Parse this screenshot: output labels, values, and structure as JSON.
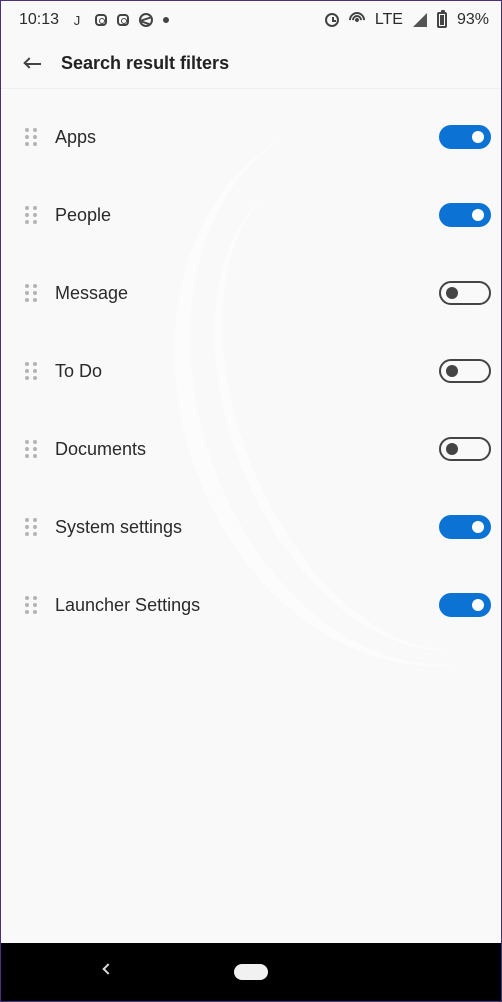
{
  "status_bar": {
    "time": "10:13",
    "left_icons": [
      "j-icon",
      "instagram-icon",
      "instagram-icon",
      "globe-icon",
      "dot-icon"
    ],
    "right_icons": [
      "alarm-icon",
      "hotspot-icon",
      "signal-icon",
      "battery-icon"
    ],
    "network": "LTE",
    "battery": "93%"
  },
  "header": {
    "title": "Search result filters"
  },
  "filters": [
    {
      "label": "Apps",
      "enabled": true
    },
    {
      "label": "People",
      "enabled": true
    },
    {
      "label": "Message",
      "enabled": false
    },
    {
      "label": "To Do",
      "enabled": false
    },
    {
      "label": "Documents",
      "enabled": false
    },
    {
      "label": "System settings",
      "enabled": true
    },
    {
      "label": "Launcher Settings",
      "enabled": true
    }
  ],
  "colors": {
    "toggle_on": "#0c73d4",
    "toggle_off_border": "#444444",
    "background": "#f9f9f9",
    "nav_bar": "#000000"
  }
}
